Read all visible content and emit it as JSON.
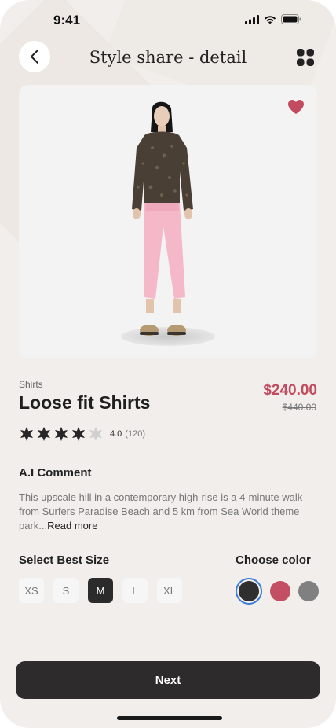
{
  "status": {
    "time": "9:41"
  },
  "header": {
    "title": "Style share - detail"
  },
  "product": {
    "category": "Shirts",
    "name": "Loose fit Shirts",
    "price": "$240.00",
    "old_price": "$440.00",
    "rating": "4.0",
    "reviews": "(120)",
    "rating_value": 4,
    "rating_max": 5,
    "favorite_color": "#c24b5f"
  },
  "ai_comment": {
    "title": "A.I Comment",
    "text": "This upscale hill in a contemporary high-rise is a 4-minute walk from Surfers Paradise Beach and 5 km from Sea World theme park...",
    "read_more": "Read more"
  },
  "sizes": {
    "title": "Select Best Size",
    "options": [
      "XS",
      "S",
      "M",
      "L",
      "XL"
    ],
    "selected": "M"
  },
  "colors": {
    "title": "Choose color",
    "options": [
      "#2f2f2f",
      "#c44e63",
      "#808080"
    ],
    "selected": "#2f2f2f",
    "accent": "#3a7bd5"
  },
  "footer": {
    "next_label": "Next"
  }
}
